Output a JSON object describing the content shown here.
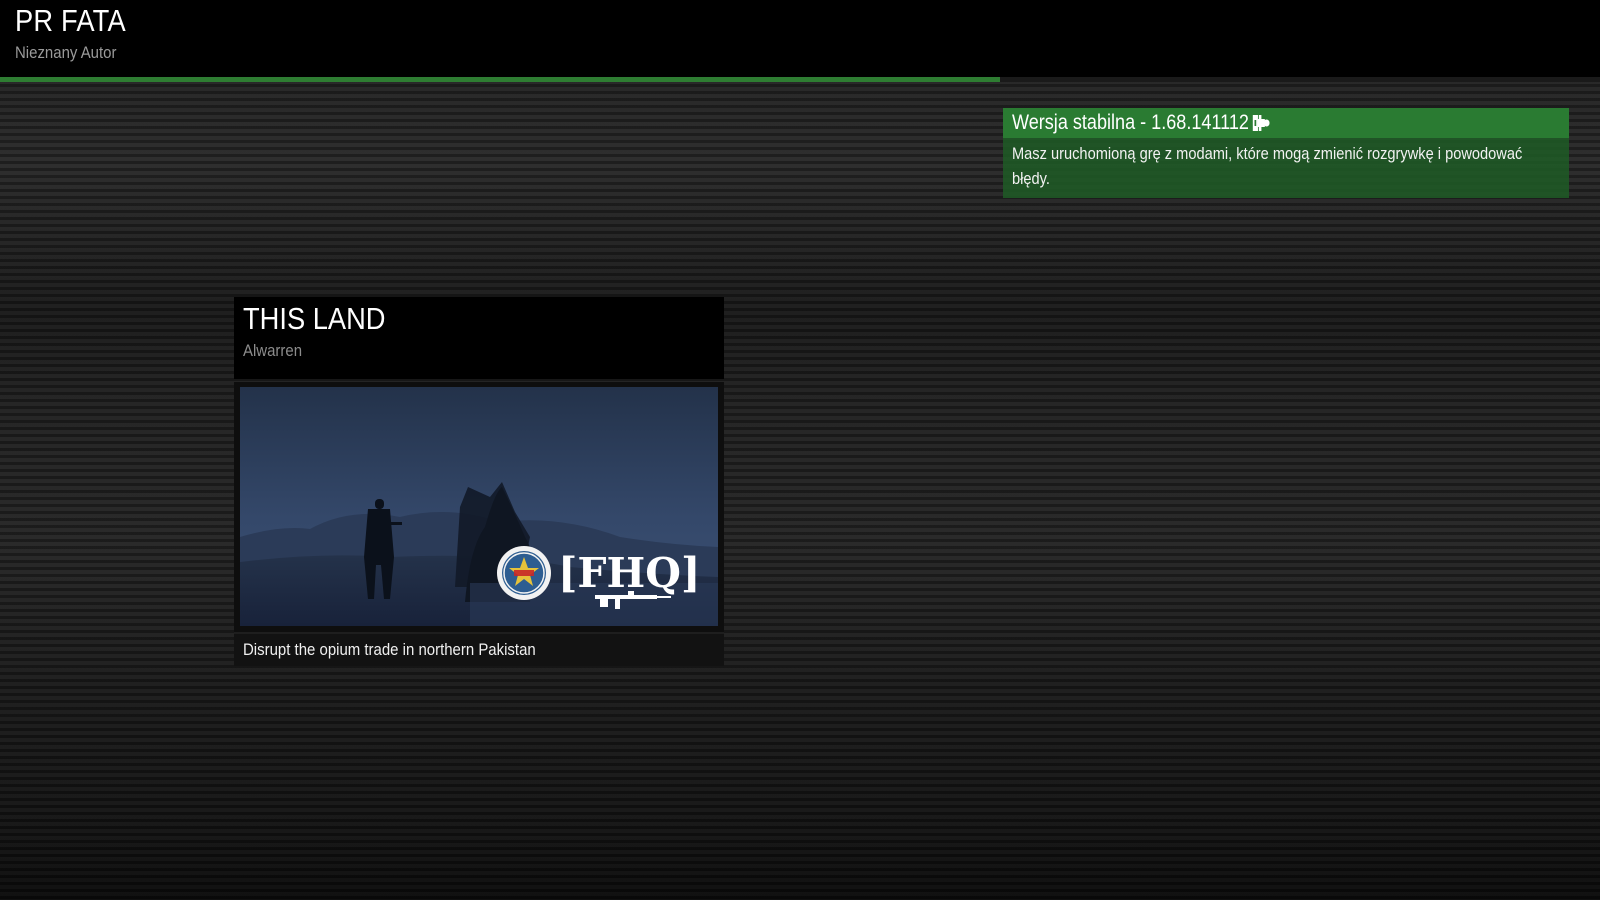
{
  "header": {
    "title": "PR FATA",
    "author": "Nieznany Autor",
    "progress_fraction": 0.625,
    "accent_color": "#2e7d32"
  },
  "version_notice": {
    "label": "Wersja stabilna - 1.68.141112",
    "icon": "puzzle-icon",
    "message": "Masz uruchomioną grę z modami, które mogą zmienić rozgrywkę i powodować błędy.",
    "header_color": "#2a7b32"
  },
  "scenario": {
    "title": "THIS LAND",
    "author": "Alwarren",
    "image_text": "[FHQ]",
    "description": "Disrupt the opium trade in northern Pakistan"
  }
}
